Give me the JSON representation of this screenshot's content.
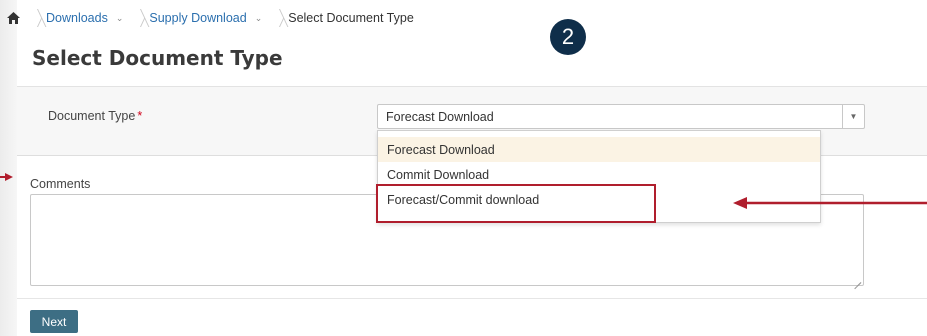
{
  "breadcrumb": {
    "items": [
      {
        "label": "Downloads"
      },
      {
        "label": "Supply Download"
      },
      {
        "label": "Select Document Type"
      }
    ]
  },
  "step_badge": "2",
  "page_title": "Select Document Type",
  "form": {
    "document_type_label": "Document Type",
    "required_marker": "*",
    "selected_value": "Forecast Download",
    "options": [
      {
        "label": "Forecast Download"
      },
      {
        "label": "Commit Download"
      },
      {
        "label": "Forecast/Commit download"
      }
    ],
    "comments_label": "Comments",
    "comments_value": ""
  },
  "actions": {
    "next_label": "Next"
  },
  "colors": {
    "link": "#2b6fae",
    "badge": "#0f2e4a",
    "annotation_red": "#b01e2d",
    "next_button": "#3d6e84",
    "selected_option_bg": "#fbf3e4"
  },
  "icons": {
    "home": "home-icon",
    "breadcrumb_chevron": "chevron-down-icon",
    "select_arrow": "chevron-down-icon"
  }
}
